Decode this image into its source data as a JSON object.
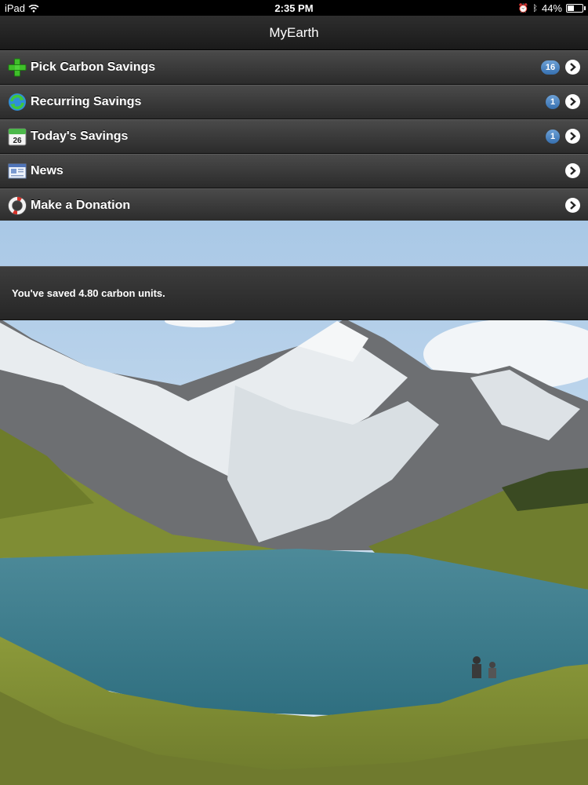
{
  "status_bar": {
    "device": "iPad",
    "time": "2:35 PM",
    "battery": "44%",
    "battery_level": 0.44
  },
  "nav": {
    "title": "MyEarth"
  },
  "menu": {
    "items": [
      {
        "label": "Pick Carbon Savings",
        "badge": "16",
        "icon": "plus-icon"
      },
      {
        "label": "Recurring Savings",
        "badge": "1",
        "icon": "recurring-icon"
      },
      {
        "label": "Today's Savings",
        "badge": "1",
        "icon": "calendar-icon",
        "calendar_day": "26"
      },
      {
        "label": "News",
        "icon": "news-icon"
      },
      {
        "label": "Make a Donation",
        "icon": "lifebuoy-icon"
      }
    ]
  },
  "info": {
    "text": "You've saved 4.80 carbon units."
  },
  "colors": {
    "badge": "#3e7bbf",
    "sky": "#c7ddef",
    "lake": "#3f7d8f",
    "grass": "#7d8d30"
  }
}
